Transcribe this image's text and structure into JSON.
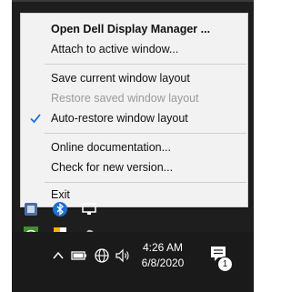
{
  "menu": {
    "items": [
      {
        "label": "Open Dell Display Manager ...",
        "bold": true
      },
      {
        "label": "Attach to active window..."
      },
      {
        "label": "Save current window layout"
      },
      {
        "label": "Restore saved window layout",
        "disabled": true
      },
      {
        "label": "Auto-restore window layout",
        "checked": true
      },
      {
        "label": "Online documentation..."
      },
      {
        "label": "Check for new version..."
      },
      {
        "label": "Exit"
      }
    ]
  },
  "taskbar": {
    "time": "4:26 AM",
    "date": "6/8/2020",
    "notification_count": "1"
  },
  "colors": {
    "menu_bg": "#f2f2f2",
    "check": "#1a73e8",
    "tray_bg": "#1e1e1e"
  }
}
